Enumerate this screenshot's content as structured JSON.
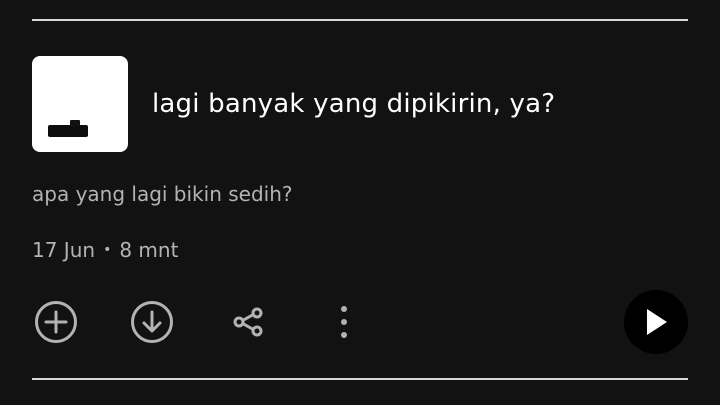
{
  "episode": {
    "title": "lagi banyak yang dipikirin, ya?",
    "description": "apa yang lagi bikin sedih?",
    "date": "17 Jun",
    "separator": "•",
    "duration": "8 mnt"
  },
  "actions": {
    "add_icon": "plus-circle-icon",
    "download_icon": "download-circle-icon",
    "share_icon": "share-icon",
    "more_icon": "more-vertical-icon",
    "play_icon": "play-icon"
  },
  "colors": {
    "background": "#121212",
    "primary_text": "#ffffff",
    "secondary_text": "#b3b3b3",
    "icon": "#b3b3b3",
    "play_button": "#000000"
  }
}
